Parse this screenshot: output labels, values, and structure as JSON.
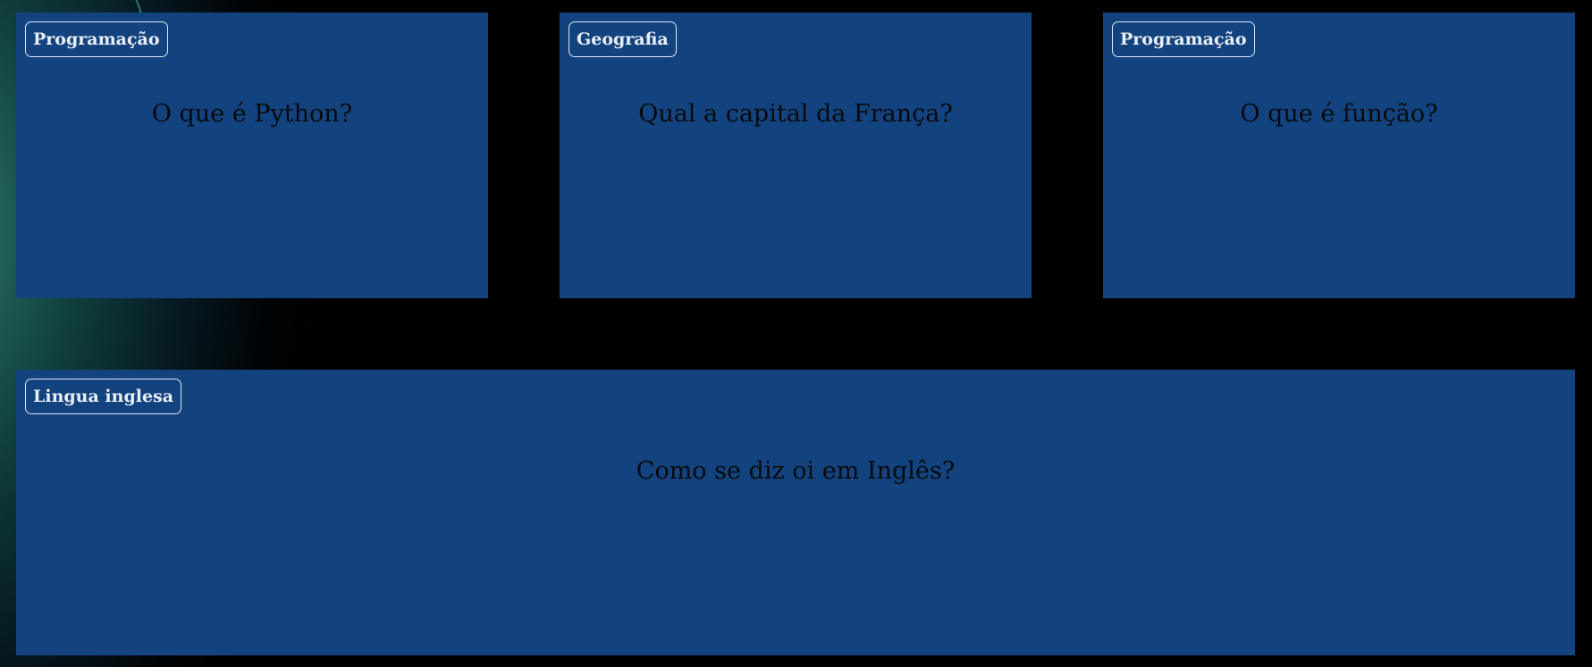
{
  "cards": [
    {
      "category": "Programação",
      "question": "O que é Python?"
    },
    {
      "category": "Geografia",
      "question": "Qual a capital da França?"
    },
    {
      "category": "Programação",
      "question": "O que é função?"
    },
    {
      "category": "Lingua inglesa",
      "question": "Como se diz oi em Inglês?"
    }
  ]
}
